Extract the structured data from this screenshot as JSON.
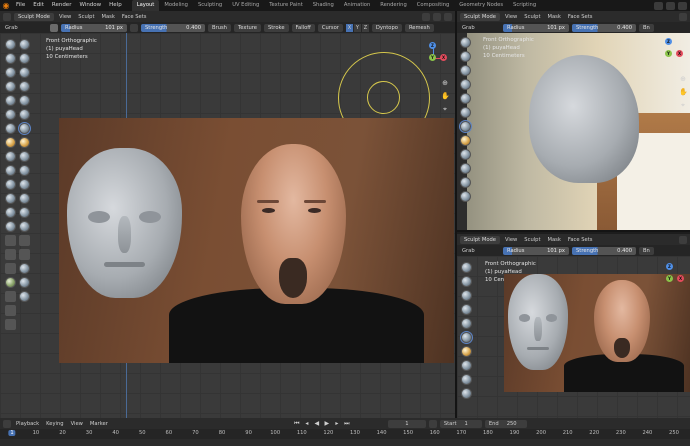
{
  "menubar": {
    "items": [
      "File",
      "Edit",
      "Render",
      "Window",
      "Help"
    ],
    "workspaces": [
      "Layout",
      "Modeling",
      "Sculpting",
      "UV Editing",
      "Texture Paint",
      "Shading",
      "Animation",
      "Rendering",
      "Compositing",
      "Geometry Nodes",
      "Scripting"
    ],
    "active_workspace": "Layout"
  },
  "main_view": {
    "mode": "Sculpt Mode",
    "menus": [
      "View",
      "Sculpt",
      "Mask",
      "Face Sets"
    ],
    "tool_name": "Grab",
    "radius_label": "Radius",
    "radius_value": "101 px",
    "strength_label": "Strength",
    "strength_value": "0.400",
    "dropdowns": [
      "Brush",
      "Texture",
      "Stroke",
      "Falloff",
      "Cursor"
    ],
    "symmetry": [
      "X",
      "Y",
      "Z"
    ],
    "dyntopo": "Dyntopo",
    "remesh": "Remesh",
    "overlay": [
      "Front Orthographic",
      "(1) puyaHead",
      "10 Centimeters"
    ]
  },
  "right_top_view": {
    "mode": "Sculpt Mode",
    "menus": [
      "View",
      "Sculpt",
      "Mask",
      "Face Sets"
    ],
    "tool_name": "Grab",
    "radius_label": "Radius",
    "radius_value": "101 px",
    "strength_label": "Strength",
    "strength_value": "0.400",
    "extra": "Bn",
    "overlay": [
      "Front Orthographic",
      "(1) puyaHead",
      "10 Centimeters"
    ]
  },
  "right_bottom_view": {
    "mode": "Sculpt Mode",
    "menus": [
      "View",
      "Sculpt",
      "Mask",
      "Face Sets"
    ],
    "tool_name": "Grab",
    "radius_label": "Radius",
    "radius_value": "101 px",
    "strength_label": "Strength",
    "strength_value": "0.400",
    "extra": "Bn",
    "overlay": [
      "Front Orthographic",
      "(1) puyaHead",
      "10 Centimeters"
    ]
  },
  "gizmo": {
    "x_label": "X",
    "y_label": "Y",
    "z_label": "Z",
    "x_color": "#e34b5c",
    "y_color": "#8bc34a",
    "z_color": "#4f8fe6"
  },
  "timeline": {
    "menus": [
      "Playback",
      "Keying",
      "View",
      "Marker"
    ],
    "current_frame": "1",
    "start_label": "Start",
    "start_value": "1",
    "end_label": "End",
    "end_value": "250",
    "ticks": [
      "1",
      "10",
      "20",
      "30",
      "40",
      "50",
      "60",
      "70",
      "80",
      "90",
      "100",
      "110",
      "120",
      "130",
      "140",
      "150",
      "160",
      "170",
      "180",
      "190",
      "200",
      "210",
      "220",
      "230",
      "240",
      "250"
    ]
  },
  "colors": {
    "accent": "#4772b3",
    "brush_circle": "#d6c84c",
    "background": "#3a3a3a"
  }
}
